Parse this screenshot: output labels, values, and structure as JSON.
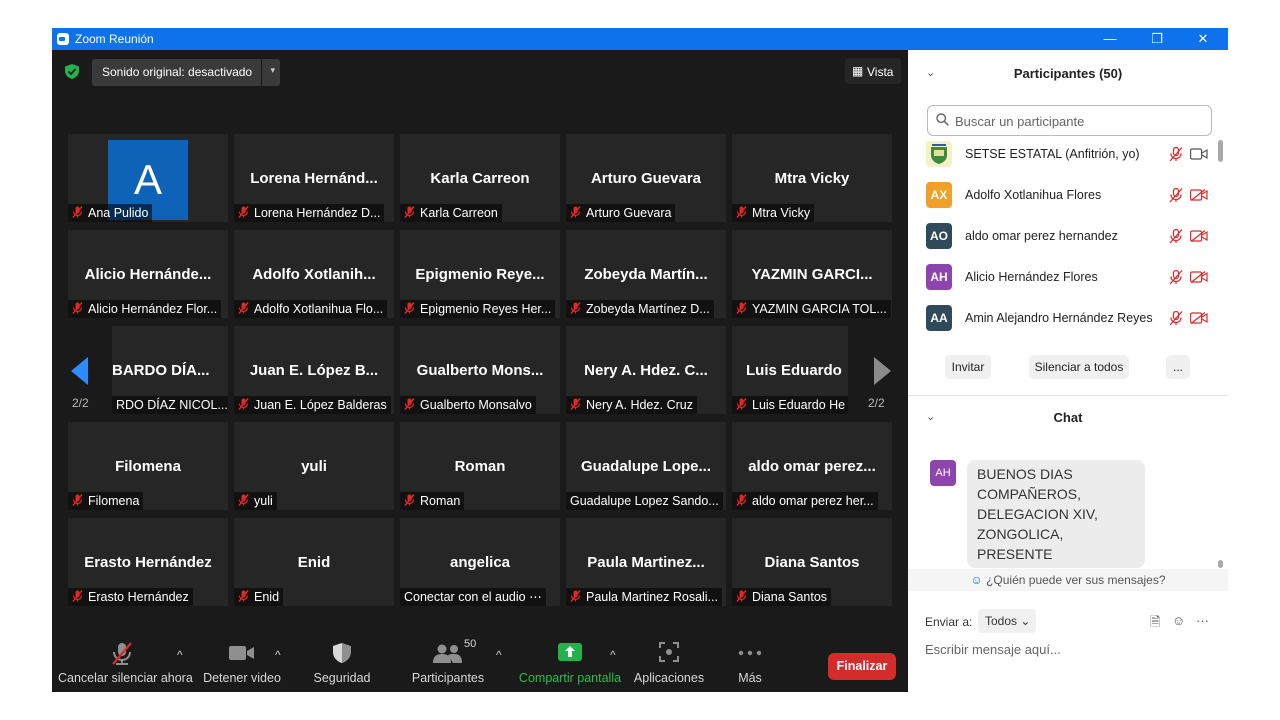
{
  "window": {
    "title": "Zoom Reunión",
    "minimize": "—",
    "restore": "❐",
    "close": "✕"
  },
  "meeting": {
    "sound_label": "Sonido original: desactivado",
    "sound_arrow": "▾",
    "view_label": "Vista",
    "view_icon": "▦",
    "page_left": "2/2",
    "page_right": "2/2",
    "tiles": [
      {
        "big": "",
        "avatar_letter": "A",
        "name": "Ana Pulido",
        "muted": true
      },
      {
        "big": "Lorena  Hernánd...",
        "name": "Lorena Hernández D...",
        "muted": true
      },
      {
        "big": "Karla Carreon",
        "name": "Karla Carreon",
        "muted": true
      },
      {
        "big": "Arturo Guevara",
        "name": "Arturo Guevara",
        "muted": true
      },
      {
        "big": "Mtra Vicky",
        "name": "Mtra Vicky",
        "muted": true
      },
      {
        "big": "Alicio  Hernánde...",
        "name": "Alicio Hernández Flor...",
        "muted": true
      },
      {
        "big": "Adolfo  Xotlanih...",
        "name": "Adolfo Xotlanihua Flo...",
        "muted": true
      },
      {
        "big": "Epigmenio  Reye...",
        "name": "Epigmenio Reyes Her...",
        "muted": true
      },
      {
        "big": "Zobeyda  Martín...",
        "name": "Zobeyda Martínez D...",
        "muted": true
      },
      {
        "big": "YAZMIN  GARCI...",
        "name": "YAZMIN GARCIA TOL...",
        "muted": true
      },
      {
        "big": "BARDO DÍA...",
        "name": "RDO DÍAZ NICOL...",
        "muted": false
      },
      {
        "big": "Juan E. López B...",
        "name": "Juan E. López Balderas",
        "muted": true
      },
      {
        "big": "Gualberto  Mons...",
        "name": "Gualberto Monsalvo",
        "muted": true
      },
      {
        "big": "Nery  A.  Hdez.  C...",
        "name": "Nery A. Hdez. Cruz",
        "muted": true
      },
      {
        "big": "Luis Eduardo I",
        "name": "Luis Eduardo He",
        "muted": true
      },
      {
        "big": "Filomena",
        "name": "Filomena",
        "muted": true
      },
      {
        "big": "yuli",
        "name": "yuli",
        "muted": true
      },
      {
        "big": "Roman",
        "name": "Roman",
        "muted": true
      },
      {
        "big": "Guadalupe  Lope...",
        "name": "Guadalupe Lopez Sando...",
        "muted": false
      },
      {
        "big": "aldo omar perez...",
        "name": "aldo omar perez her...",
        "muted": true
      },
      {
        "big": "Erasto Hernández",
        "name": "Erasto Hernández",
        "muted": true
      },
      {
        "big": "Enid",
        "name": "Enid",
        "muted": true
      },
      {
        "big": "angelica",
        "name": "Conectar con el audio ⋯",
        "muted": false
      },
      {
        "big": "Paula  Martinez...",
        "name": "Paula Martinez Rosali...",
        "muted": true
      },
      {
        "big": "Diana Santos",
        "name": "Diana Santos",
        "muted": true
      }
    ]
  },
  "toolbar": {
    "unmute": "Cancelar silenciar ahora",
    "video": "Detener video",
    "security": "Seguridad",
    "participants": "Participantes",
    "participants_count": "50",
    "share": "Compartir pantalla",
    "apps": "Aplicaciones",
    "more": "Más",
    "end": "Finalizar",
    "caret": "^"
  },
  "participants_panel": {
    "title": "Participantes (50)",
    "search_placeholder": "Buscar un participante",
    "list": [
      {
        "initials": "",
        "name": "SETSE ESTATAL (Anfitrión, yo)",
        "color": "#e9e2a0",
        "cam_off": false
      },
      {
        "initials": "AX",
        "name": "Adolfo Xotlanihua Flores",
        "color": "#f0a028",
        "cam_off": true
      },
      {
        "initials": "AO",
        "name": "aldo omar perez hernandez",
        "color": "#2f4a5a",
        "cam_off": true
      },
      {
        "initials": "AH",
        "name": "Alicio Hernández Flores",
        "color": "#8e44ad",
        "cam_off": true
      },
      {
        "initials": "AA",
        "name": "Amin Alejandro Hernández Reyes",
        "color": "#2f4a5a",
        "cam_off": true
      }
    ],
    "invite": "Invitar",
    "mute_all": "Silenciar a todos",
    "more": "..."
  },
  "chat_panel": {
    "title": "Chat",
    "message_initials": "AH",
    "message_text": "BUENOS DIAS COMPAÑEROS, DELEGACION XIV, ZONGOLICA, PRESENTE",
    "who_can_see": "¿Quién puede ver sus mensajes?",
    "send_to_label": "Enviar a:",
    "send_to_value": "Todos ⌄",
    "input_placeholder": "Escribir mensaje aquí..."
  },
  "colors": {
    "titlebar": "#0e72ed",
    "meeting_bg": "#1a1a1a",
    "tile_bg": "#262626",
    "muted_red": "#e02828",
    "end_red": "#d42b2b",
    "share_green": "#23b24b",
    "nav_arrow": "#2d8cff"
  }
}
